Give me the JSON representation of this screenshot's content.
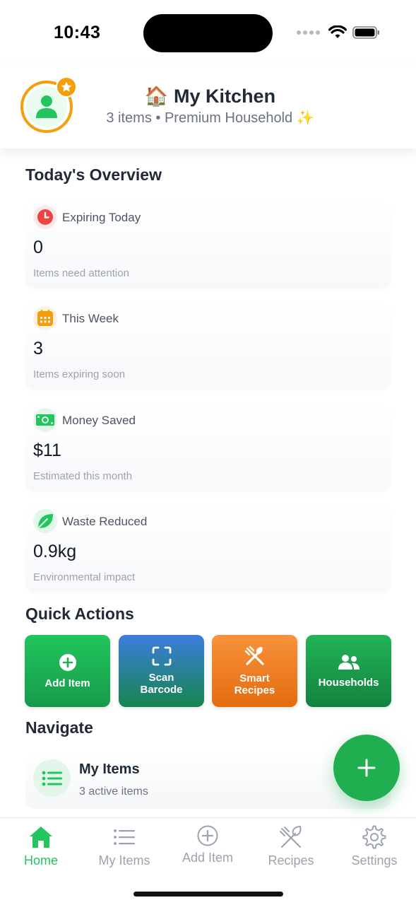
{
  "status_bar": {
    "time": "10:43"
  },
  "header": {
    "house_emoji": "🏠",
    "title": "My Kitchen",
    "subtitle": "3 items • Premium Household ✨"
  },
  "overview": {
    "title": "Today's Overview",
    "cards": [
      {
        "icon": "clock-icon",
        "label": "Expiring Today",
        "value": "0",
        "caption": "Items need attention",
        "color": "#ef4444",
        "bg": "#fde8e8"
      },
      {
        "icon": "calendar-icon",
        "label": "This Week",
        "value": "3",
        "caption": "Items expiring soon",
        "color": "#f59e0b",
        "bg": "#fdf1dc"
      },
      {
        "icon": "money-icon",
        "label": "Money Saved",
        "value": "$11",
        "caption": "Estimated this month",
        "color": "#22c55e",
        "bg": "#e3f6ea"
      },
      {
        "icon": "leaf-icon",
        "label": "Waste Reduced",
        "value": "0.9kg",
        "caption": "Environmental impact",
        "color": "#22c55e",
        "bg": "#e3f6ea"
      }
    ]
  },
  "quick_actions": {
    "title": "Quick Actions",
    "items": [
      {
        "label": "Add Item",
        "icon": "plus-circle-icon"
      },
      {
        "label": "Scan\nBarcode",
        "icon": "scan-icon"
      },
      {
        "label": "Smart\nRecipes",
        "icon": "utensils-icon"
      },
      {
        "label": "Households",
        "icon": "people-icon"
      }
    ]
  },
  "navigate": {
    "title": "Navigate",
    "items": [
      {
        "title": "My Items",
        "subtitle": "3 active items",
        "icon": "list-icon"
      }
    ]
  },
  "tabs": [
    {
      "label": "Home",
      "icon": "home-icon",
      "active": true
    },
    {
      "label": "My Items",
      "icon": "list-icon",
      "active": false
    },
    {
      "label": "Add Item",
      "icon": "plus-circle-icon",
      "active": false
    },
    {
      "label": "Recipes",
      "icon": "utensils-icon",
      "active": false
    },
    {
      "label": "Settings",
      "icon": "gear-icon",
      "active": false
    }
  ],
  "colors": {
    "accent": "#22c55e",
    "premium": "#f59e0b"
  }
}
